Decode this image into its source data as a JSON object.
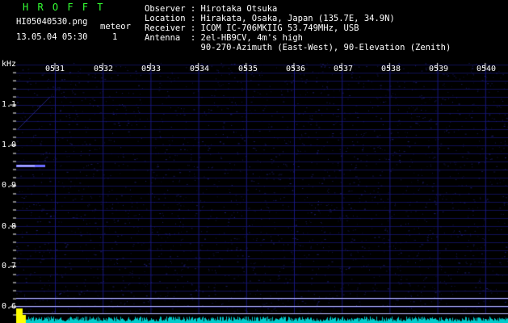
{
  "header": {
    "app_title": "H R O F F T",
    "filename": "HI05040530.png",
    "datetime": "13.05.04 05:30",
    "meteor_label": "meteor",
    "meteor_count": "1"
  },
  "info": {
    "observer": "Observer : Hirotaka Otsuka",
    "location": "Location : Hirakata, Osaka, Japan (135.7E, 34.9N)",
    "receiver": "Receiver : ICOM IC-706MKIIG 53.749MHz, USB",
    "antenna": "Antenna  : 2el-HB9CV, 4m's high",
    "antenna2": "           90-270-Azimuth (East-West), 90-Elevation (Zenith)"
  },
  "axes": {
    "y_unit": "kHz",
    "y_ticks": [
      "1.1",
      "1.0",
      "0.9",
      "0.8",
      "0.7",
      "0.6"
    ],
    "x_ticks": [
      "0531",
      "0532",
      "0533",
      "0534",
      "0535",
      "0536",
      "0537",
      "0538",
      "0539",
      "0540"
    ]
  },
  "colors": {
    "background": "#000000",
    "grid": "#1a1a8c",
    "noise": "#2a2aa0",
    "baseline": "#00cccc",
    "signal": "#ffff00",
    "title": "#33ff33"
  }
}
